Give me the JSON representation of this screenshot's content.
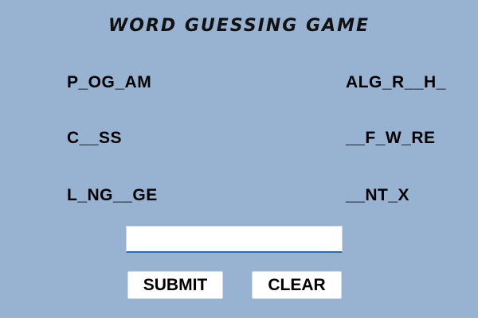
{
  "title": "WORD GUESSING GAME",
  "words": {
    "left": [
      "P_OG_AM",
      "C__SS",
      "L_NG__GE"
    ],
    "right": [
      "ALG_R__H_",
      "__F_W_RE",
      "__NT_X"
    ]
  },
  "input": {
    "value": "",
    "placeholder": ""
  },
  "buttons": {
    "submit": "SUBMIT",
    "clear": "CLEAR"
  }
}
